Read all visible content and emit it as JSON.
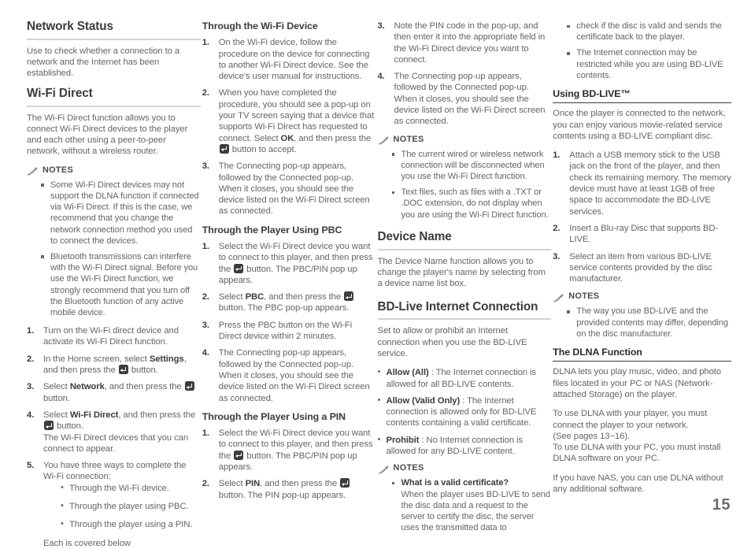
{
  "page": {
    "number": "15"
  },
  "icons": {
    "enter_button": "enter-button-icon",
    "notes": "pencil-icon"
  },
  "labels": {
    "notes": "NOTES"
  },
  "column1": {
    "network_status": {
      "heading": "Network Status",
      "body": "Use to check whether a connection to a network and the Internet has been established."
    },
    "wifi_direct": {
      "heading": "Wi-Fi Direct",
      "body": "The Wi-Fi Direct function allows you to connect Wi-Fi Direct devices to the player and each other using a peer-to-peer network, without a wireless router.",
      "notes": [
        "Some Wi-Fi Direct devices may not support the DLNA function if connected via Wi-Fi Direct. If this is the case, we recommend that you change the network connection method you used to connect the devices.",
        "Bluetooth transmissions can interfere with the Wi-Fi Direct signal. Before you use the Wi-Fi Direct function, we strongly recommend that you turn off the Bluetooth function of any active mobile device."
      ],
      "step1": "Turn on the Wi-Fi direct device and activate its Wi-Fi Direct function.",
      "step2_a": "In the Home screen, select ",
      "step2_bold": "Settings",
      "step2_b": ", and then press the ",
      "step2_c": " button.",
      "step3_a": "Select ",
      "step3_bold": "Network",
      "step3_b": ", and then press the ",
      "step3_c": " button.",
      "step4_a": "Select ",
      "step4_bold": "Wi-Fi Direct",
      "step4_b": ", and then press the ",
      "step4_c": " button.",
      "step4_extra": "The Wi-Fi Direct devices that you can connect to appear.",
      "step5": "You have three ways to complete the Wi-Fi connection:",
      "step5_options": [
        "Through the Wi-Fi device.",
        "Through the player using PBC.",
        "Through the player using a PIN."
      ],
      "step5_tail": "Each is covered below"
    }
  },
  "column2": {
    "through_wifi_device": {
      "heading": "Through the Wi-Fi Device",
      "step1": "On the Wi-Fi device, follow the procedure on the device for connecting to another Wi-Fi Direct device. See the device's user manual for instructions.",
      "step2_a": "When you have completed the procedure, you should see a pop-up on your TV screen saying that a device that supports Wi-Fi Direct has requested to connect. Select ",
      "step2_bold": "OK",
      "step2_b": ", and then press the ",
      "step2_c": " button to accept.",
      "step3": "The Connecting pop-up appears, followed by the Connected pop-up. When it closes, you should see the device listed on the Wi-Fi Direct screen as connected."
    },
    "through_player_pbc": {
      "heading": "Through the Player Using PBC",
      "step1_a": "Select the Wi-Fi Direct device you want to connect to this player, and then press the ",
      "step1_b": " button. The PBC/PIN pop up appears.",
      "step2_a": "Select ",
      "step2_bold": "PBC",
      "step2_b": ", and then press the ",
      "step2_c": " button. The PBC pop-up appears.",
      "step3": "Press the PBC button on the Wi-Fi Direct device within 2 minutes.",
      "step4": "The Connecting pop-up appears, followed by the Connected pop-up. When it closes, you should see the device listed on the Wi-Fi Direct screen as connected."
    },
    "through_player_pin": {
      "heading": "Through the Player Using a PIN",
      "step1_a": "Select the Wi-Fi Direct device you want to connect to this player, and then press the ",
      "step1_b": " button. The PBC/PIN pop up appears.",
      "step2_a": "Select ",
      "step2_bold": "PIN",
      "step2_b": ", and then press the ",
      "step2_c": " button. The PIN pop-up appears."
    }
  },
  "column3": {
    "pin_steps": {
      "step3": "Note the PIN code in the pop-up, and then enter it into the appropriate field in the Wi-Fi Direct device you want to connect.",
      "step4": "The Connecting pop-up appears, followed by the Connected pop-up. When it closes, you should see the device listed on the Wi-Fi Direct screen as connected.",
      "notes": [
        "The current wired or wireless network connection will be disconnected when you use the Wi-Fi Direct function.",
        "Text files, such as files with a .TXT or .DOC extension, do not display when you are using the Wi-Fi Direct function."
      ]
    },
    "device_name": {
      "heading": "Device Name",
      "body": "The Device Name function allows you to change the player's name by selecting from a device name list box."
    },
    "bd_live_internet": {
      "heading": "BD-Live Internet Connection",
      "body": "Set to allow or prohibit an Internet connection when you use the BD-LIVE service.",
      "options": [
        {
          "term": "Allow (All)",
          "sep": " : ",
          "desc": "The Internet connection is allowed for all BD-LIVE contents."
        },
        {
          "term": "Allow (Valid Only)",
          "sep": " : ",
          "desc": "The Internet connection is allowed only for BD-LIVE contents containing a valid certificate."
        },
        {
          "term": "Prohibit",
          "sep": " : ",
          "desc": "No Internet connection is allowed for any BD-LIVE content."
        }
      ],
      "note_title": "What is a valid certificate?",
      "note_body": "When the player uses BD-LIVE to send the disc data and a request to the server to certify the disc, the server uses the transmitted data to"
    }
  },
  "column4": {
    "continued_note": "check if the disc is valid and sends the certificate back to the player.",
    "note2": "The Internet connection may be restricted while you are using BD-LIVE contents.",
    "using_bdlive": {
      "heading": "Using BD-LIVE™",
      "body": "Once the player is connected to the network, you can enjoy various movie-related service contents using a BD-LIVE compliant disc.",
      "step1": "Attach a USB memory stick to the USB jack on the front of the player, and then check its remaining memory. The memory device must have at least 1GB of free space to accommodate the BD-LIVE services.",
      "step2": "Insert a Blu-ray Disc that supports BD-LIVE.",
      "step3": "Select an item from various BD-LIVE service contents provided by the disc manufacturer.",
      "notes": [
        "The way you use BD-LIVE and the provided contents may differ, depending on the disc manufacturer."
      ]
    },
    "dlna": {
      "heading": "The DLNA Function",
      "p1": "DLNA lets you play music, video, and photo files located in your PC or NAS (Network-attached Storage) on the player.",
      "p2": "To use DLNA with your player, you must connect the player to your network.\n(See pages 13~16).\nTo use DLNA with your PC, you must install DLNA software on your PC.",
      "p3": "If you have NAS, you can use DLNA without any additional software."
    }
  }
}
